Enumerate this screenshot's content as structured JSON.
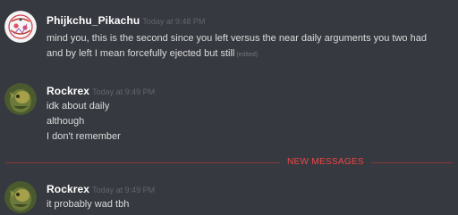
{
  "messages": [
    {
      "username": "Phijkchu_Pikachu",
      "timestamp": "Today at 9:48 PM",
      "lines": [
        "mind you, this is the second since you left versus the near daily arguments you two had",
        "and by left I mean forcefully ejected but still"
      ],
      "edited": "(edited)",
      "avatar": "pikachu-avatar-icon"
    },
    {
      "username": "Rockrex",
      "timestamp": "Today at 9:49 PM",
      "lines": [
        "idk about daily",
        "although",
        "I don't remember"
      ],
      "avatar": "rockrex-avatar-icon"
    },
    {
      "username": "Rockrex",
      "timestamp": "Today at 9:49 PM",
      "lines": [
        "it probably wad tbh"
      ],
      "avatar": "rockrex-avatar-icon"
    }
  ],
  "divider": {
    "label": "NEW MESSAGES",
    "color": "#f04747"
  },
  "colors": {
    "background": "#36393f",
    "username": "#ffffff",
    "message_text": "#dcddde",
    "timestamp": "#62666d"
  }
}
